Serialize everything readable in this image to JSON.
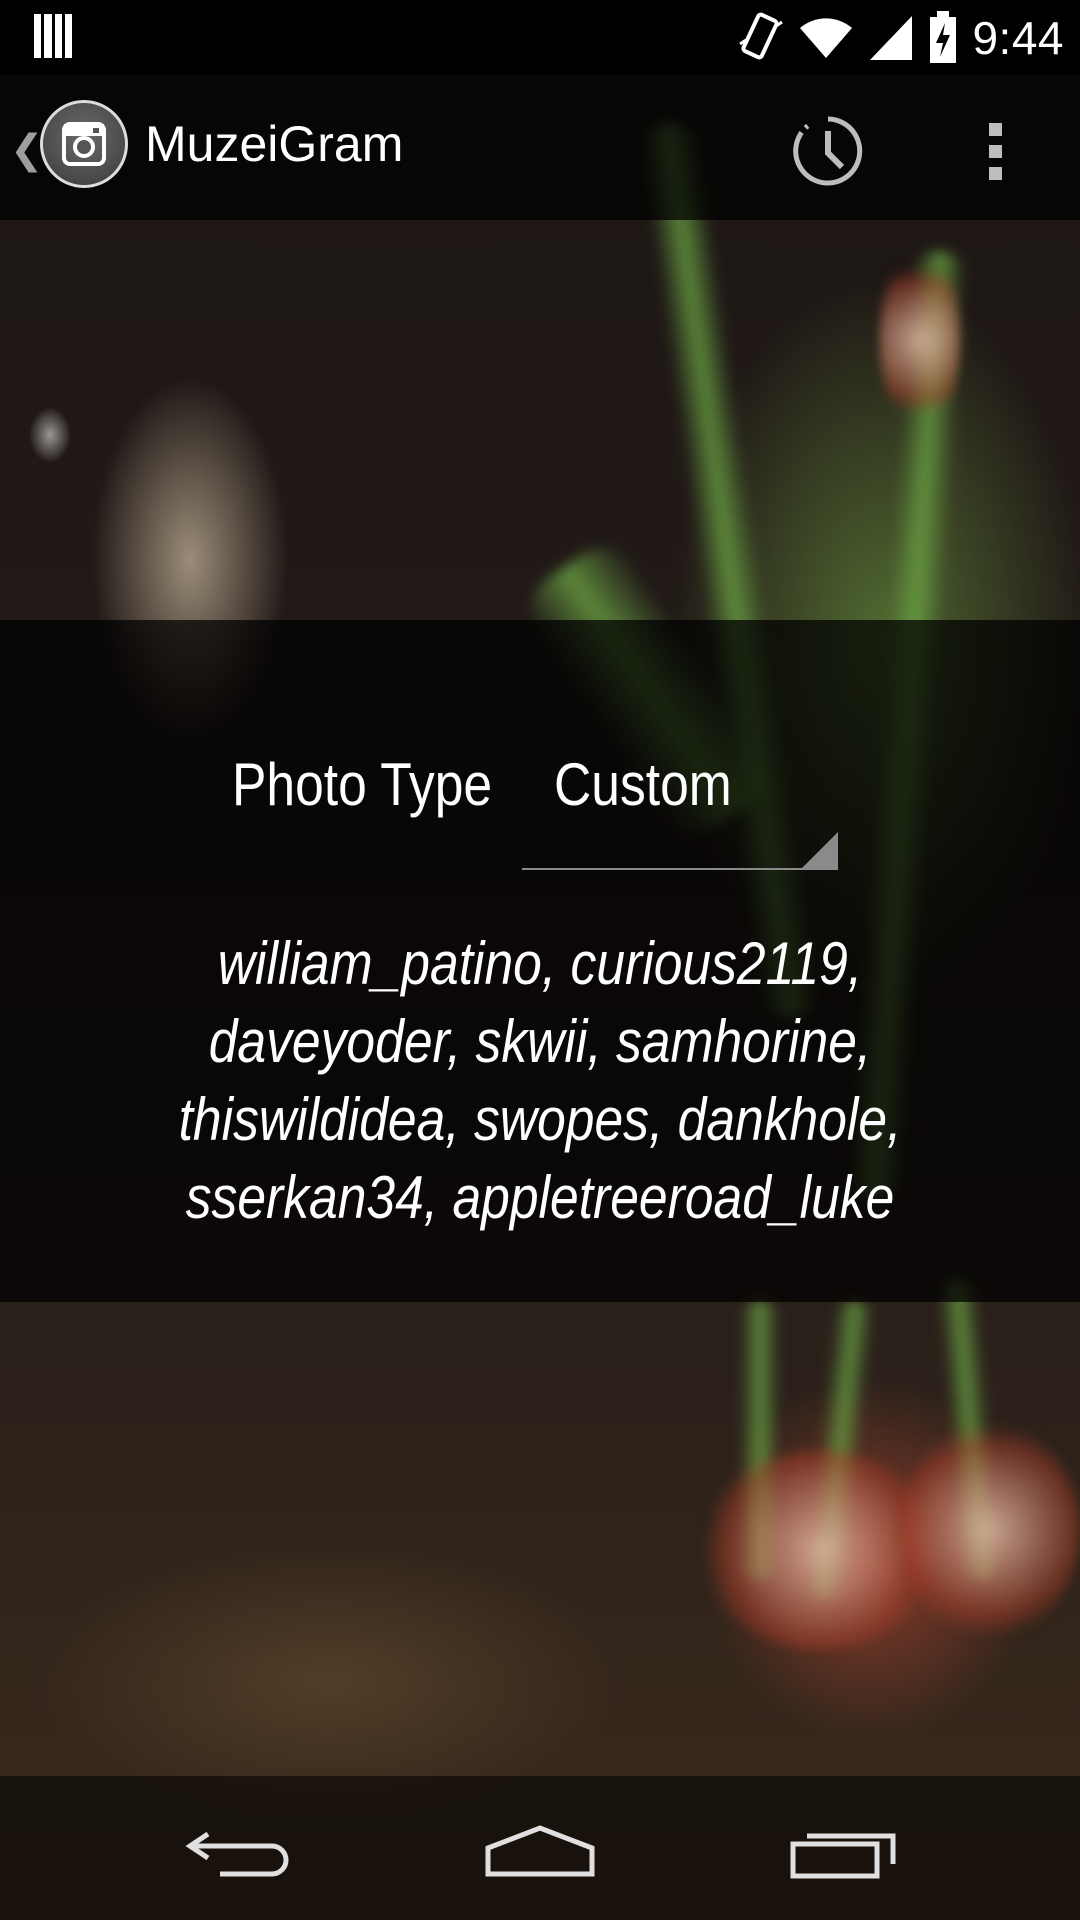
{
  "status_bar": {
    "time": "9:44",
    "icons": [
      "notification-bars-icon",
      "vibrate-icon",
      "wifi-icon",
      "cell-signal-icon",
      "battery-charging-icon"
    ]
  },
  "action_bar": {
    "title": "MuzeiGram",
    "icons": [
      "up-caret-icon",
      "instagram-camera-icon",
      "schedule-clock-icon",
      "overflow-menu-icon"
    ]
  },
  "settings": {
    "photo_type_label": "Photo Type",
    "photo_type_value": "Custom",
    "usernames_lines": [
      "william_patino, curious2119,",
      "daveyoder, skwii, samhorine,",
      "thiswildidea, swopes, dankhole,",
      "sserkan34, appletreeroad_luke"
    ]
  },
  "nav_bar": {
    "icons": [
      "back-icon",
      "home-icon",
      "recents-icon"
    ]
  },
  "colors": {
    "overlay": "#000000",
    "text": "#ffffff",
    "control_gray": "#8a8a8a"
  }
}
